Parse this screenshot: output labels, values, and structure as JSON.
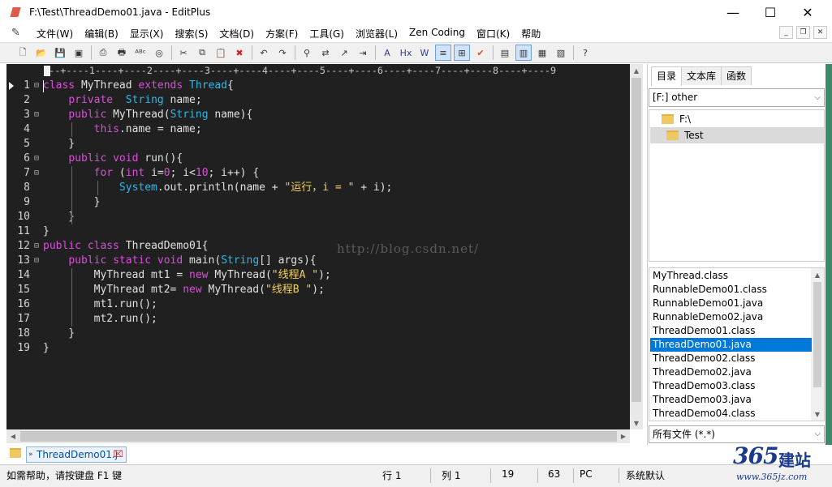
{
  "window": {
    "title": "F:\\Test\\ThreadDemo01.java - EditPlus",
    "min_glyph": "—",
    "max_glyph": "☐",
    "close_glyph": "✕"
  },
  "menu": [
    "文件(W)",
    "编辑(B)",
    "显示(X)",
    "搜索(S)",
    "文档(D)",
    "方案(F)",
    "工具(G)",
    "浏览器(L)",
    "Zen Coding",
    "窗口(K)",
    "帮助"
  ],
  "toolbar": {
    "icons": [
      "new-file-icon",
      "open-file-icon",
      "save-icon",
      "save-all-icon",
      "print-preview-icon",
      "print-icon",
      "spell-check-icon",
      "browser-preview-icon",
      "cut-icon",
      "copy-icon",
      "paste-icon",
      "delete-icon",
      "undo-icon",
      "redo-icon",
      "find-icon",
      "replace-icon",
      "goto-icon",
      "indent-icon",
      "font-icon",
      "hex-icon",
      "word-wrap-icon",
      "line-number-icon",
      "column-icon",
      "check-icon",
      "view-1-icon",
      "view-2-icon",
      "view-3-icon",
      "view-4-icon",
      "help-icon"
    ]
  },
  "editor": {
    "ruler": "---+----1----+----2----+----3----+----4----+----5----+----6----+----7----+----8----+----9",
    "watermark": "http://blog.csdn.net/",
    "lines": [
      {
        "n": "1",
        "fold": "⊟",
        "html": [
          [
            "kw",
            "class"
          ],
          [
            "tx",
            " MyThread "
          ],
          [
            "kw",
            "extends"
          ],
          [
            "tx",
            " "
          ],
          [
            "ty",
            "Thread"
          ],
          [
            "tx",
            "{"
          ]
        ]
      },
      {
        "n": "2",
        "fold": "",
        "html": [
          [
            "tx",
            "    "
          ],
          [
            "kw",
            "private"
          ],
          [
            "tx",
            "  "
          ],
          [
            "ty",
            "String"
          ],
          [
            "tx",
            " name;"
          ]
        ]
      },
      {
        "n": "3",
        "fold": "⊟",
        "html": [
          [
            "tx",
            "    "
          ],
          [
            "kw",
            "public"
          ],
          [
            "tx",
            " MyThread("
          ],
          [
            "ty",
            "String"
          ],
          [
            "tx",
            " name){"
          ]
        ]
      },
      {
        "n": "4",
        "fold": "",
        "html": [
          [
            "tx",
            "        "
          ],
          [
            "kw",
            "this"
          ],
          [
            "tx",
            ".name = name;"
          ]
        ]
      },
      {
        "n": "5",
        "fold": "",
        "html": [
          [
            "tx",
            "    }"
          ]
        ]
      },
      {
        "n": "6",
        "fold": "⊟",
        "html": [
          [
            "tx",
            "    "
          ],
          [
            "kw",
            "public"
          ],
          [
            "tx",
            " "
          ],
          [
            "kw",
            "void"
          ],
          [
            "tx",
            " run(){"
          ]
        ]
      },
      {
        "n": "7",
        "fold": "⊟",
        "html": [
          [
            "tx",
            "        "
          ],
          [
            "kw",
            "for"
          ],
          [
            "tx",
            " ("
          ],
          [
            "kw",
            "int"
          ],
          [
            "tx",
            " i="
          ],
          [
            "nm",
            "0"
          ],
          [
            "tx",
            "; i<"
          ],
          [
            "nm",
            "10"
          ],
          [
            "tx",
            "; i++) {"
          ]
        ]
      },
      {
        "n": "8",
        "fold": "",
        "html": [
          [
            "tx",
            "            "
          ],
          [
            "fn",
            "System"
          ],
          [
            "tx",
            ".out.println(name + "
          ],
          [
            "str",
            "\"运行，i = \""
          ],
          [
            "tx",
            " + i);"
          ]
        ]
      },
      {
        "n": "9",
        "fold": "",
        "html": [
          [
            "tx",
            "        }"
          ]
        ]
      },
      {
        "n": "10",
        "fold": "",
        "html": [
          [
            "tx",
            "    }"
          ]
        ]
      },
      {
        "n": "11",
        "fold": "",
        "html": [
          [
            "tx",
            "}"
          ]
        ]
      },
      {
        "n": "12",
        "fold": "⊟",
        "html": [
          [
            "kw",
            "public"
          ],
          [
            "tx",
            " "
          ],
          [
            "kw",
            "class"
          ],
          [
            "tx",
            " ThreadDemo01{"
          ]
        ]
      },
      {
        "n": "13",
        "fold": "⊟",
        "html": [
          [
            "tx",
            "    "
          ],
          [
            "kw",
            "public"
          ],
          [
            "tx",
            " "
          ],
          [
            "kw",
            "static"
          ],
          [
            "tx",
            " "
          ],
          [
            "kw",
            "void"
          ],
          [
            "tx",
            " main("
          ],
          [
            "ty",
            "String"
          ],
          [
            "tx",
            "[] args){"
          ]
        ]
      },
      {
        "n": "14",
        "fold": "",
        "html": [
          [
            "tx",
            "        MyThread mt1 = "
          ],
          [
            "kw",
            "new"
          ],
          [
            "tx",
            " MyThread("
          ],
          [
            "str",
            "\"线程A \""
          ],
          [
            "tx",
            ");"
          ]
        ]
      },
      {
        "n": "15",
        "fold": "",
        "html": [
          [
            "tx",
            "        MyThread mt2= "
          ],
          [
            "kw",
            "new"
          ],
          [
            "tx",
            " MyThread("
          ],
          [
            "str",
            "\"线程B \""
          ],
          [
            "tx",
            ");"
          ]
        ]
      },
      {
        "n": "16",
        "fold": "",
        "html": [
          [
            "tx",
            "        mt1.run();"
          ]
        ]
      },
      {
        "n": "17",
        "fold": "",
        "html": [
          [
            "tx",
            "        mt2.run();"
          ]
        ]
      },
      {
        "n": "18",
        "fold": "",
        "html": [
          [
            "tx",
            "    }"
          ]
        ]
      },
      {
        "n": "19",
        "fold": "",
        "html": [
          [
            "tx",
            "}"
          ]
        ]
      }
    ]
  },
  "side": {
    "tabs": [
      "目录",
      "文本库",
      "函数"
    ],
    "drive": "[F:] other",
    "dirs": [
      "F:\\",
      "Test"
    ],
    "files": [
      "MyThread.class",
      "RunnableDemo01.class",
      "RunnableDemo01.java",
      "RunnableDemo02.java",
      "ThreadDemo01.class",
      "ThreadDemo01.java",
      "ThreadDemo02.class",
      "ThreadDemo02.java",
      "ThreadDemo03.class",
      "ThreadDemo03.java",
      "ThreadDemo04.class"
    ],
    "selected_file": "ThreadDemo01.java",
    "filter": "所有文件 (*.*)"
  },
  "doc_tab": {
    "label": "ThreadDemo01.j",
    "close": "⌧"
  },
  "status": {
    "help": "如需帮助，请按键盘 F1 键",
    "row": "行 1",
    "col": "列 1",
    "lines": "19",
    "chars": "63",
    "os": "PC",
    "encoding": "系统默认"
  },
  "logo": {
    "num": "365",
    "cn": "建站",
    "url": "www.365jz.com"
  },
  "colors": {
    "keyword": "#d94fd9",
    "type": "#2eb8e6",
    "string": "#f0d060",
    "editor_bg": "#202020",
    "selection": "#0078d7"
  }
}
